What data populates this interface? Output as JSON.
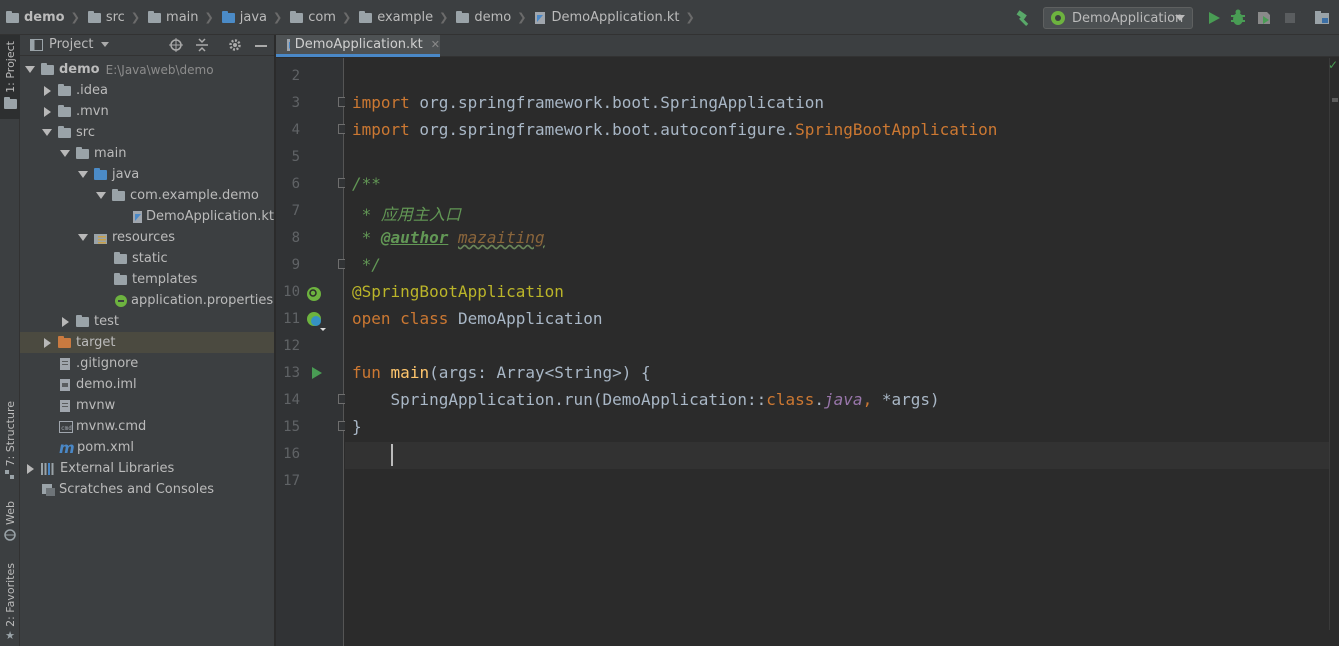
{
  "breadcrumbs": [
    "demo",
    "src",
    "main",
    "java",
    "com",
    "example",
    "demo",
    "DemoApplication.kt"
  ],
  "toolbar": {
    "run_config": "DemoApplication"
  },
  "stripe": {
    "project": "1: Project",
    "structure": "7: Structure",
    "web": "Web",
    "favorites": "2: Favorites"
  },
  "project_panel": {
    "title": "Project",
    "tree": [
      {
        "name": "demo",
        "path": "E:\\Java\\web\\demo"
      },
      {
        "name": ".idea"
      },
      {
        "name": ".mvn"
      },
      {
        "name": "src"
      },
      {
        "name": "main"
      },
      {
        "name": "java"
      },
      {
        "name": "com.example.demo"
      },
      {
        "name": "DemoApplication.kt"
      },
      {
        "name": "resources"
      },
      {
        "name": "static"
      },
      {
        "name": "templates"
      },
      {
        "name": "application.properties"
      },
      {
        "name": "test"
      },
      {
        "name": "target"
      },
      {
        "name": ".gitignore"
      },
      {
        "name": "demo.iml"
      },
      {
        "name": "mvnw"
      },
      {
        "name": "mvnw.cmd"
      },
      {
        "name": "pom.xml"
      },
      {
        "name": "External Libraries"
      },
      {
        "name": "Scratches and Consoles"
      }
    ]
  },
  "editor": {
    "tab": "DemoApplication.kt",
    "line_numbers": [
      "2",
      "3",
      "4",
      "5",
      "6",
      "7",
      "8",
      "9",
      "10",
      "11",
      "12",
      "13",
      "14",
      "15",
      "16",
      "17"
    ],
    "code": {
      "l3_kw": "import",
      "l3_rest": " org.springframework.boot.SpringApplication",
      "l4_kw": "import",
      "l4_rest": " org.springframework.boot.autoconfigure.",
      "l4_cls": "SpringBootApplication",
      "l6": "/**",
      "l7": " * 应用主入口",
      "l8_pre": " * ",
      "l8_tag": "@author",
      "l8_sp": " ",
      "l8_name": "mazaiting",
      "l9": " */",
      "l10": "@SpringBootApplication",
      "l11_kw1": "open",
      "l11_kw2": "class",
      "l11_name": "DemoApplication",
      "l13_kw": "fun",
      "l13_fn": "main",
      "l13_rest": "(args: Array<String>) {",
      "l14_a": "    SpringApplication.run(DemoApplication::",
      "l14_kw": "class",
      "l14_dot": ".",
      "l14_java": "java",
      "l14_comma": ",",
      "l14_b": " *args)",
      "l15": "}"
    }
  }
}
